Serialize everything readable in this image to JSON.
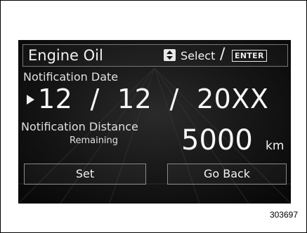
{
  "header": {
    "title": "Engine Oil",
    "select_label": "Select",
    "separator": "/",
    "enter_label": "ENTER"
  },
  "notification_date": {
    "label": "Notification Date",
    "value": "12  /  12  /  20XX"
  },
  "notification_distance": {
    "label": "Notification Distance",
    "sublabel": "Remaining",
    "value": "5000",
    "unit": "km"
  },
  "buttons": {
    "set_label": "Set",
    "go_back_label": "Go Back"
  },
  "figure_number": "303697",
  "icons": {
    "updown": "up-down-arrows-icon",
    "pointer": "play-pointer-icon"
  },
  "colors": {
    "screen_bg": "#151515",
    "text": "#f2f2f2"
  }
}
